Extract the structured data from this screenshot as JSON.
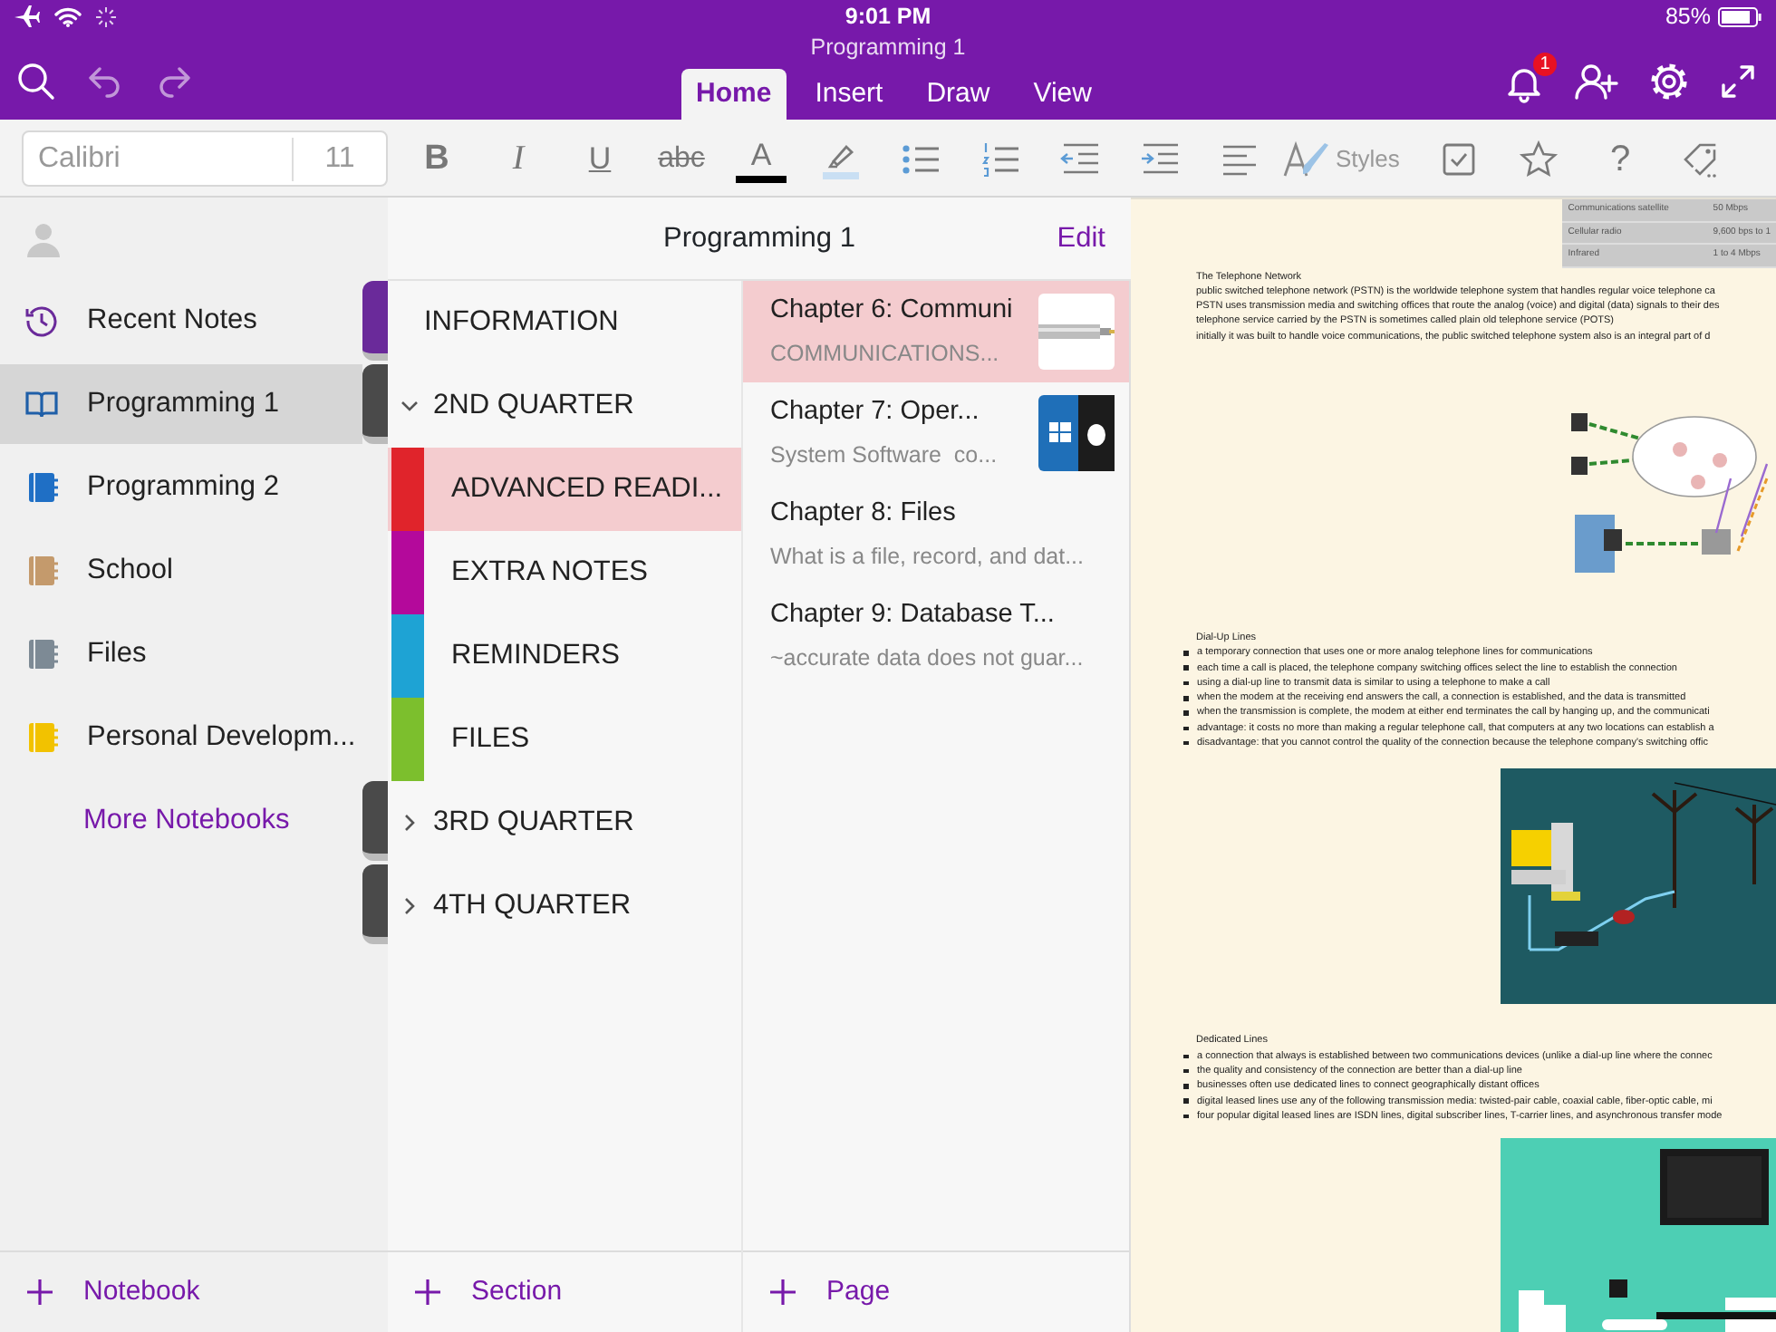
{
  "status_bar": {
    "time": "9:01 PM",
    "battery": "85%"
  },
  "window": {
    "title": "Programming 1"
  },
  "tabs": [
    {
      "label": "Home",
      "selected": true
    },
    {
      "label": "Insert",
      "selected": false
    },
    {
      "label": "Draw",
      "selected": false
    },
    {
      "label": "View",
      "selected": false
    }
  ],
  "notification_badge": "1",
  "ribbon": {
    "font": "Calibri",
    "size": "11",
    "format_buttons": [
      {
        "kind": "bold",
        "label": "B"
      },
      {
        "kind": "italic",
        "label": "I"
      },
      {
        "kind": "underline",
        "label": "U"
      },
      {
        "kind": "strike",
        "label": "abc"
      },
      {
        "kind": "font_color",
        "label": "A",
        "color": "#000000"
      }
    ],
    "styles_label": "Styles",
    "help_label": "?"
  },
  "notebooks": {
    "items": [
      {
        "kind": "recent",
        "label": "Recent Notes",
        "selected": false,
        "spine": {
          "color": "#6a2a9a"
        }
      },
      {
        "kind": "notebook",
        "label": "Programming 1",
        "color": "#1f5fa8",
        "selected": true,
        "spine": {
          "color": "#4a4a4a"
        }
      },
      {
        "kind": "notebook",
        "label": "Programming 2",
        "color": "#1f6fc5",
        "selected": false
      },
      {
        "kind": "notebook",
        "label": "School",
        "color": "#c49a6c",
        "selected": false
      },
      {
        "kind": "notebook",
        "label": "Files",
        "color": "#7d8a95",
        "selected": false
      },
      {
        "kind": "notebook",
        "label": "Personal Developm...",
        "color": "#f2c200",
        "selected": false
      }
    ],
    "more": {
      "label": "More Notebooks",
      "spine": {
        "color": "#4a4a4a"
      }
    },
    "trailing_spines": [
      {
        "color": "#4a4a4a"
      }
    ],
    "add": "Notebook"
  },
  "sections": {
    "header": "Programming 1",
    "edit": "Edit",
    "items": [
      {
        "kind": "section",
        "label": "INFORMATION",
        "selected": false
      },
      {
        "kind": "group",
        "label": "2ND QUARTER",
        "expanded": true,
        "children": [
          {
            "label": "ADVANCED READI...",
            "color": "#e0242b",
            "selected": true
          },
          {
            "label": "EXTRA NOTES",
            "color": "#b4099b",
            "selected": false
          },
          {
            "label": "REMINDERS",
            "color": "#1ea3d4",
            "selected": false
          },
          {
            "label": "FILES",
            "color": "#7cbf2d",
            "selected": false
          }
        ]
      },
      {
        "kind": "group",
        "label": "3RD QUARTER",
        "expanded": false
      },
      {
        "kind": "group",
        "label": "4TH QUARTER",
        "expanded": false
      }
    ],
    "add": "Section"
  },
  "pages": {
    "items": [
      {
        "title": "Chapter 6: Communi",
        "preview": "COMMUNICATIONS...",
        "selected": true,
        "thumbnail": {
          "kind": "picture"
        }
      },
      {
        "title": "Chapter 7: Oper...",
        "preview": "System Software  co...",
        "selected": false,
        "thumbnail": {
          "kind": "picture"
        }
      },
      {
        "title": "Chapter 8: Files",
        "preview": "What is a file, record, and dat...",
        "selected": false
      },
      {
        "title": "Chapter 9: Database T...",
        "preview": "~accurate data does not guar...",
        "selected": false
      }
    ],
    "add": "Page"
  },
  "note": {
    "table": {
      "rows": [
        [
          "Communications satellite",
          "50 Mbps"
        ],
        [
          "Cellular radio",
          "9,600 bps to 1"
        ],
        [
          "Infrared",
          "1 to 4 Mbps"
        ]
      ]
    },
    "blocks": [
      {
        "kind": "paragraph",
        "heading": "The Telephone Network",
        "lines": [
          "public switched telephone network (PSTN) is the worldwide telephone system that handles regular voice telephone ca",
          "PSTN uses transmission media and switching offices that route the analog (voice) and digital (data) signals to their des",
          "telephone service carried by the PSTN is sometimes called plain old telephone service (POTS)",
          "initially it was built to handle voice communications, the public switched telephone system also is an integral part of d"
        ]
      },
      {
        "kind": "picture"
      },
      {
        "kind": "bulleted",
        "heading": "Dial-Up Lines",
        "lines": [
          "a temporary connection that uses one or more analog telephone lines for communications",
          "each time a call is placed, the telephone company switching offices select the line to establish the connection",
          "using a dial-up line to transmit data is similar to using a telephone to make a call",
          "when the modem at the receiving end answers the call, a connection is established, and the data is transmitted",
          "when the transmission is complete, the modem at either end terminates the call by hanging up, and the communicati",
          "advantage: it costs no more than making a regular telephone call, that computers at any two locations can establish a",
          "disadvantage: that you cannot control the quality of the connection because the telephone company's switching offic"
        ]
      },
      {
        "kind": "picture"
      },
      {
        "kind": "bulleted",
        "heading": "Dedicated Lines",
        "lines": [
          "a connection that always is established between two communications devices (unlike a dial-up line where the connec",
          "the quality and consistency of the connection are better than a dial-up line",
          "businesses often use dedicated lines to connect geographically distant offices",
          "digital leased lines use any of the following transmission media: twisted-pair cable, coaxial cable, fiber-optic cable, mi",
          "four popular digital leased lines are ISDN lines, digital subscriber lines, T-carrier lines, and asynchronous transfer mode"
        ]
      },
      {
        "kind": "picture"
      }
    ]
  }
}
